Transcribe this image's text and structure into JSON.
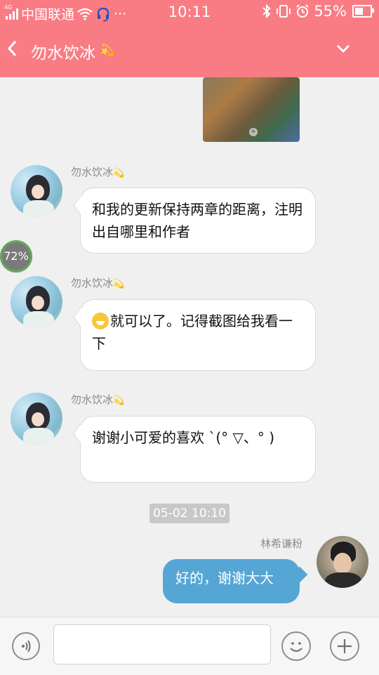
{
  "status_bar": {
    "network_type": "4G",
    "carrier": "中国联通",
    "more": "···",
    "time": "10:11",
    "battery_percent": "55%",
    "battery_level": 0.55
  },
  "header": {
    "chat_title": "勿水饮冰",
    "title_decoration": "💫"
  },
  "messages": [
    {
      "type": "image"
    },
    {
      "sender": "勿水饮冰",
      "text": "和我的更新保持两章的距离，注明出自哪里和作者"
    },
    {
      "sender": "勿水饮冰",
      "text": "就可以了。记得截图给我看一下",
      "has_emoji": true
    },
    {
      "sender": "勿水饮冰",
      "text": "谢谢小可爱的喜欢 ˋ(°  ▽、°  )"
    },
    {
      "timestamp": "05-02 10:10"
    },
    {
      "sender": "林希谦粉",
      "text": "好的，谢谢大大",
      "outgoing": true
    }
  ],
  "progress_badge": "72%",
  "composer": {
    "input_value": "",
    "input_placeholder": ""
  },
  "colors": {
    "header_bg": "#f97c84",
    "outgoing_bubble": "#55a6d4",
    "chat_bg": "#f0f0f0"
  },
  "icons": {
    "back": "chevron-left-icon",
    "dropdown": "chevron-down-icon",
    "voice": "voice-icon",
    "emoji": "smiley-icon",
    "add": "plus-icon"
  }
}
